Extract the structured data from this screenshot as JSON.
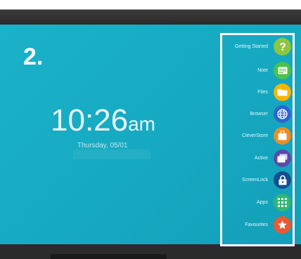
{
  "step_label": "2.",
  "clock": {
    "time": "10:26",
    "ampm": "am",
    "date": "Thursday, 05/01"
  },
  "menu": {
    "items": [
      {
        "label": "Getting Started",
        "icon": "help-icon",
        "color": "#8dc63f"
      },
      {
        "label": "Note",
        "icon": "note-icon",
        "color": "#4cc24a"
      },
      {
        "label": "Files",
        "icon": "folder-icon",
        "color": "#f7b500"
      },
      {
        "label": "Browser",
        "icon": "globe-icon",
        "color": "#2d63d6"
      },
      {
        "label": "CleverStore",
        "icon": "store-icon",
        "color": "#f08c1e"
      },
      {
        "label": "Active",
        "icon": "windows-icon",
        "color": "#5b4aa8"
      },
      {
        "label": "ScreenLock",
        "icon": "lock-icon",
        "color": "#114f8f"
      },
      {
        "label": "Apps",
        "icon": "apps-grid-icon",
        "color": "#2eb872"
      },
      {
        "label": "Favourites",
        "icon": "star-icon",
        "color": "#e85a32"
      }
    ]
  }
}
